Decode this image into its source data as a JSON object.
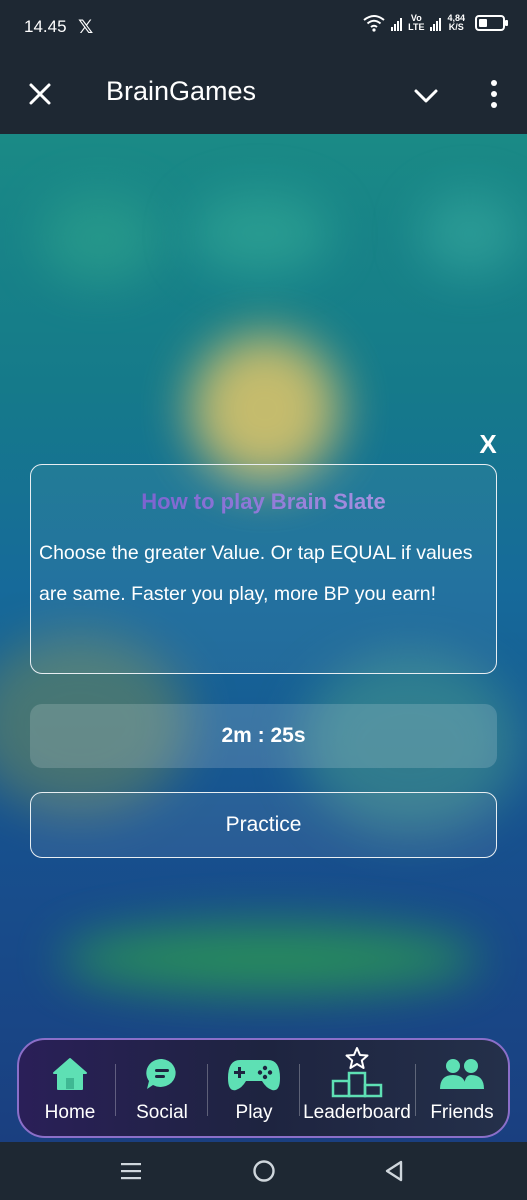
{
  "status_bar": {
    "time": "14.45",
    "x_icon": "x-logo-icon",
    "network_top": "Vo",
    "network_bottom": "LTE",
    "speed_top": "4,84",
    "speed_bottom": "K/S",
    "battery_level": 0.25
  },
  "app_bar": {
    "title": "BrainGames",
    "close_icon": "close-icon",
    "chevron_icon": "chevron-down-icon",
    "more_icon": "more-vertical-icon"
  },
  "dialog": {
    "close_label": "X",
    "title": "How to play Brain Slate",
    "description": "Choose the greater Value. Or tap EQUAL if values are same. Faster you play, more BP you earn!",
    "timer": "2m : 25s",
    "practice_label": "Practice"
  },
  "bottom_nav": {
    "items": [
      {
        "label": "Home",
        "icon": "home-icon"
      },
      {
        "label": "Social",
        "icon": "chat-bubble-icon"
      },
      {
        "label": "Play",
        "icon": "gamepad-icon"
      },
      {
        "label": "Leaderboard",
        "icon": "podium-icon"
      },
      {
        "label": "Friends",
        "icon": "friends-icon"
      }
    ]
  },
  "colors": {
    "app_bar": "#1e2833",
    "accent_teal": "#5ee0b4",
    "title_gradient_start": "#6a4fc9",
    "title_gradient_end": "#b9a7e8",
    "nav_border": "#8b6fc9"
  }
}
